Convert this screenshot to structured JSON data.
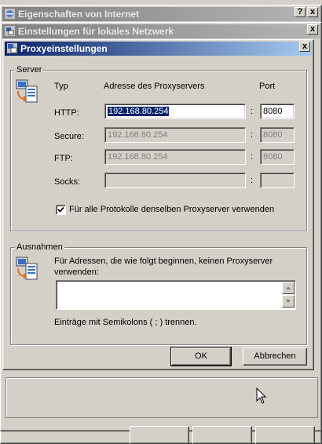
{
  "window1": {
    "title": "Eigenschaften von Internet",
    "help_label": "?",
    "close_label": "x"
  },
  "window2": {
    "title": "Einstellungen für lokales Netzwerk",
    "close_label": "x"
  },
  "dialog": {
    "title": "Proxyeinstellungen",
    "close_label": "x",
    "server": {
      "group_label": "Server",
      "col_type": "Typ",
      "col_address": "Adresse des Proxyservers",
      "col_port": "Port",
      "rows": [
        {
          "label": "HTTP:",
          "address": "192.168.80.254",
          "port": "8080",
          "enabled": true
        },
        {
          "label": "Secure:",
          "address": "192.168.80.254",
          "port": "8080",
          "enabled": false
        },
        {
          "label": "FTP:",
          "address": "192.168.80.254",
          "port": "8080",
          "enabled": false
        },
        {
          "label": "Socks:",
          "address": "",
          "port": "",
          "enabled": false
        }
      ],
      "colon": ":",
      "same_proxy_label": "Für alle Protokolle denselben Proxyserver verwenden",
      "same_proxy_checked": true
    },
    "exceptions": {
      "group_label": "Ausnahmen",
      "description": "Für Adressen, die wie folgt beginnen, keinen Proxyserver verwenden:",
      "value": "",
      "hint": "Einträge mit Semikolons ( ; ) trennen."
    },
    "ok_label": "OK",
    "cancel_label": "Abbrechen"
  },
  "colors": {
    "face": "#d4d0c8",
    "active_title": "#0a246a",
    "inactive_title": "#808080"
  }
}
